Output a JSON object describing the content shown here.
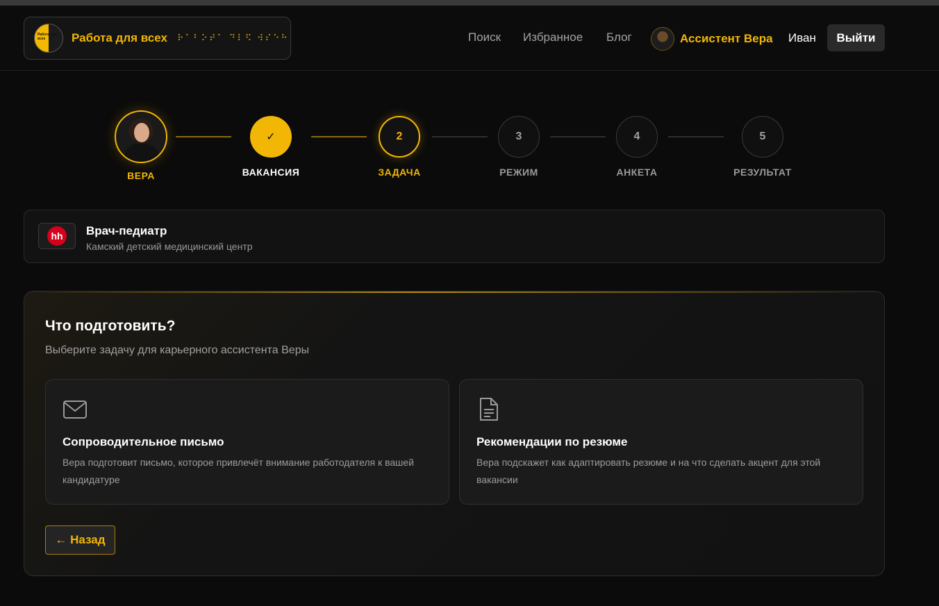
{
  "header": {
    "brand_title": "Работа для всех",
    "brand_braille": "⠗⠁⠃⠕⠞⠁ ⠙⠇⠫ ⠺⠎⠑⠓",
    "brand_logo_text": "Работа для всех",
    "nav": {
      "search": "Поиск",
      "favorites": "Избранное",
      "blog": "Блог"
    },
    "assistant_label": "Ассистент Вера",
    "user_name": "Иван",
    "logout_label": "Выйти"
  },
  "stepper": {
    "vera_label": "ВЕРА",
    "steps": [
      {
        "marker": "✓",
        "label": "ВАКАНСИЯ",
        "state": "done"
      },
      {
        "marker": "2",
        "label": "ЗАДАЧА",
        "state": "active"
      },
      {
        "marker": "3",
        "label": "РЕЖИМ",
        "state": "pending"
      },
      {
        "marker": "4",
        "label": "АНКЕТА",
        "state": "pending"
      },
      {
        "marker": "5",
        "label": "РЕЗУЛЬТАТ",
        "state": "pending"
      }
    ]
  },
  "vacancy": {
    "source_logo": "hh",
    "title": "Врач-педиатр",
    "company": "Камский детский медицинский центр"
  },
  "task": {
    "title": "Что подготовить?",
    "subtitle": "Выберите задачу для карьерного ассистента Веры",
    "options": [
      {
        "icon": "envelope-icon",
        "title": "Сопроводительное письмо",
        "description": "Вера подготовит письмо, которое привлечёт внимание работодателя к вашей кандидатуре"
      },
      {
        "icon": "document-icon",
        "title": "Рекомендации по резюме",
        "description": "Вера подскажет как адаптировать резюме и на что сделать акцент для этой вакансии"
      }
    ],
    "back_label": "← Назад"
  },
  "colors": {
    "accent": "#f2b705",
    "background": "#0b0b0b",
    "hh_red": "#d6001c"
  }
}
